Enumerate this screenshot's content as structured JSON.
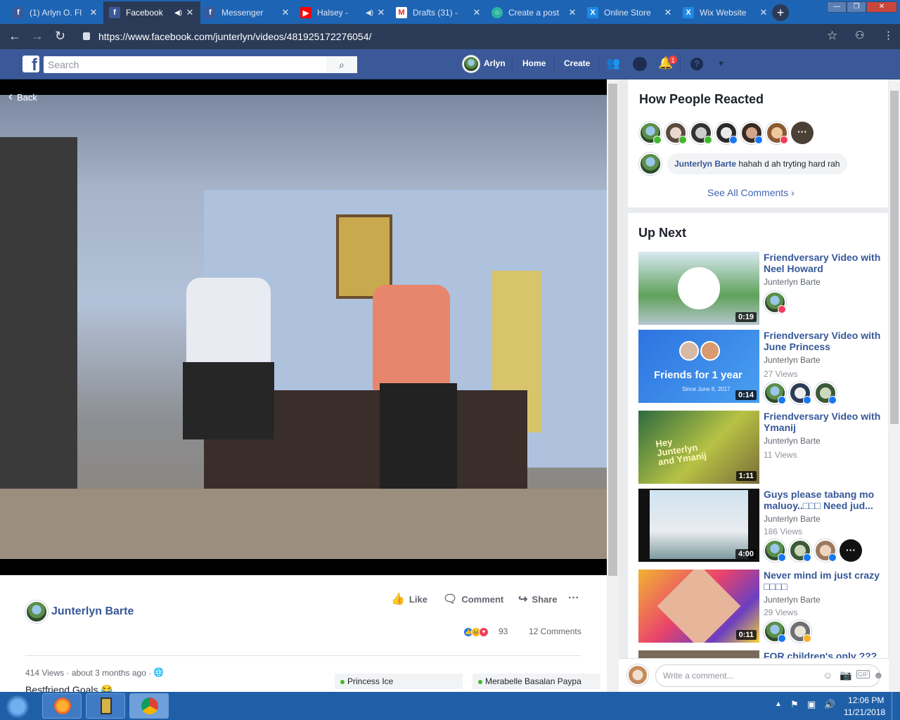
{
  "tabs": [
    {
      "title": "(1) Arlyn O. Fl",
      "favicon": "facebook-icon",
      "color": "#3b5998",
      "active": false,
      "audio": false
    },
    {
      "title": "Facebook",
      "favicon": "facebook-icon",
      "color": "#3b5998",
      "active": true,
      "audio": true
    },
    {
      "title": "Messenger",
      "favicon": "facebook-icon",
      "color": "#3b5998",
      "active": false,
      "audio": false
    },
    {
      "title": "Halsey - ",
      "favicon": "youtube-icon",
      "color": "#ff0000",
      "active": false,
      "audio": true
    },
    {
      "title": "Drafts (31) - ",
      "favicon": "gmail-icon",
      "color": "#ffffff",
      "active": false,
      "audio": false
    },
    {
      "title": "Create a post",
      "favicon": "create-icon",
      "color": "#2bb5a0",
      "active": false,
      "audio": false
    },
    {
      "title": "Online Store",
      "favicon": "wix-icon",
      "color": "#1e88e5",
      "active": false,
      "audio": false
    },
    {
      "title": "Wix Website",
      "favicon": "wix-icon",
      "color": "#1e88e5",
      "active": false,
      "audio": false
    }
  ],
  "address": {
    "url": "https://www.facebook.com/junterlyn/videos/481925172276054/"
  },
  "fb": {
    "search_placeholder": "Search",
    "user": "Arlyn",
    "home": "Home",
    "create": "Create",
    "notif_count": "1"
  },
  "video": {
    "back_label": "Back"
  },
  "post": {
    "author": "Junterlyn Barte",
    "like": "Like",
    "comment": "Comment",
    "share": "Share",
    "reaction_count": "93",
    "comments_count": "12 Comments",
    "meta": "414 Views · about 3 months ago ·",
    "caption": "Bestfriend Goals 😂",
    "pill1": "Princess Ice",
    "pill2": "Merabelle Basalan Paypa"
  },
  "reactions": {
    "heading": "How People Reacted",
    "comment_author": "Junterlyn Barte",
    "comment_text": "hahah d ah tryting hard rah",
    "see_all": "See All Comments"
  },
  "up_next": {
    "heading": "Up Next",
    "items": [
      {
        "title": "Friendversary Video with Neel Howard",
        "author": "Junterlyn Barte",
        "views": "",
        "duration": "0:19"
      },
      {
        "title": "Friendversary Video with June Princess",
        "author": "Junterlyn Barte",
        "views": "27 Views",
        "duration": "0:14",
        "thumb_text": "Friends for 1 year",
        "thumb_sub": "Since June 8, 2017"
      },
      {
        "title": "Friendversary Video with Ymanij",
        "author": "Junterlyn Barte",
        "views": "11 Views",
        "duration": "1:11",
        "thumb_text": "Hey Junterlyn and Ymanij"
      },
      {
        "title": "Guys please tabang mo maluoy..□□□ Need jud...",
        "author": "Junterlyn Barte",
        "views": "186 Views",
        "duration": "4:00"
      },
      {
        "title": "Never mind im just crazy □□□□",
        "author": "Junterlyn Barte",
        "views": "29 Views",
        "duration": "0:11"
      },
      {
        "title": "FOR children's only ???",
        "author": "",
        "views": "",
        "duration": ""
      }
    ]
  },
  "comment_box": {
    "placeholder": "Write a comment..."
  },
  "taskbar": {
    "time": "12:06 PM",
    "date": "11/21/2018"
  }
}
